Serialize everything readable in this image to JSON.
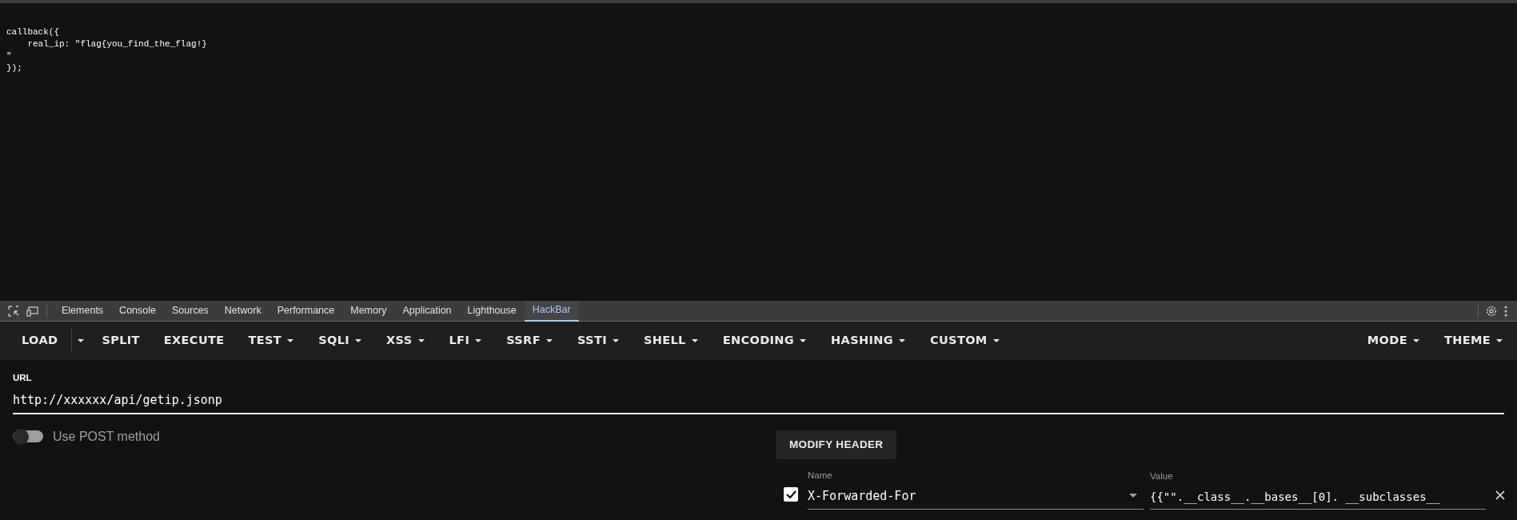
{
  "page": {
    "lines": [
      "callback({",
      "    real_ip: \"flag{you_find_the_flag!}",
      "\"",
      "});"
    ]
  },
  "devtools": {
    "tabs": [
      {
        "label": "Elements",
        "selected": false
      },
      {
        "label": "Console",
        "selected": false
      },
      {
        "label": "Sources",
        "selected": false
      },
      {
        "label": "Network",
        "selected": false
      },
      {
        "label": "Performance",
        "selected": false
      },
      {
        "label": "Memory",
        "selected": false
      },
      {
        "label": "Application",
        "selected": false
      },
      {
        "label": "Lighthouse",
        "selected": false
      },
      {
        "label": "HackBar",
        "selected": true
      }
    ]
  },
  "toolbar": {
    "left": [
      {
        "label": "LOAD",
        "kind": "split"
      },
      {
        "label": "SPLIT",
        "kind": "plain"
      },
      {
        "label": "EXECUTE",
        "kind": "plain"
      },
      {
        "label": "TEST",
        "kind": "menu"
      },
      {
        "label": "SQLI",
        "kind": "menu"
      },
      {
        "label": "XSS",
        "kind": "menu"
      },
      {
        "label": "LFI",
        "kind": "menu"
      },
      {
        "label": "SSRF",
        "kind": "menu"
      },
      {
        "label": "SSTI",
        "kind": "menu"
      },
      {
        "label": "SHELL",
        "kind": "menu"
      },
      {
        "label": "ENCODING",
        "kind": "menu"
      },
      {
        "label": "HASHING",
        "kind": "menu"
      },
      {
        "label": "CUSTOM",
        "kind": "menu"
      }
    ],
    "right": [
      {
        "label": "MODE",
        "kind": "menu"
      },
      {
        "label": "THEME",
        "kind": "menu"
      }
    ]
  },
  "url": {
    "label": "URL",
    "value": "http://xxxxxx/api/getip.jsonp"
  },
  "post_toggle": {
    "label": "Use POST method",
    "on": false
  },
  "modify_header": {
    "button": "MODIFY HEADER",
    "name_label": "Name",
    "value_label": "Value",
    "headers": [
      {
        "checked": true,
        "name": "X-Forwarded-For",
        "value": "{{\"\".__class__.__bases__[0]. __subclasses__"
      }
    ]
  }
}
